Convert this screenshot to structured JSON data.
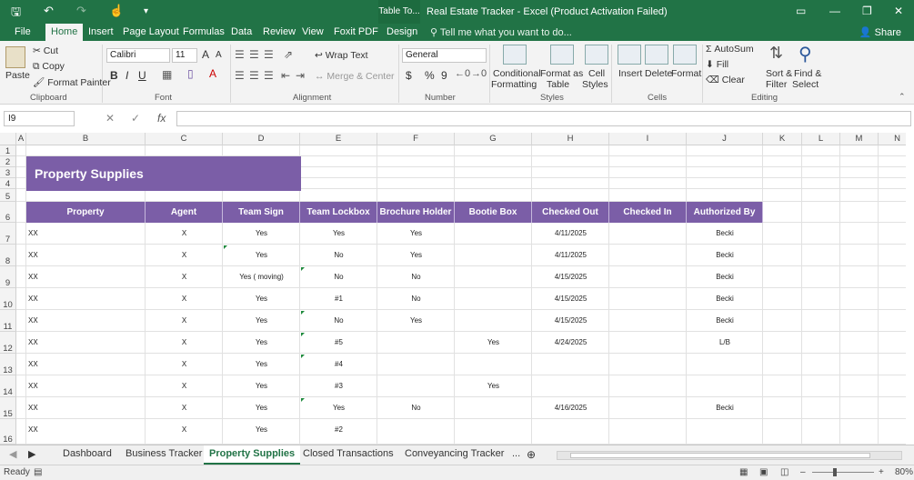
{
  "titlebar": {
    "context_tab": "Table To...",
    "title": "Real Estate Tracker - Excel (Product Activation Failed)"
  },
  "tabs": [
    "File",
    "Home",
    "Insert",
    "Page Layout",
    "Formulas",
    "Data",
    "Review",
    "View",
    "Foxit PDF",
    "Design"
  ],
  "tell_me": "Tell me what you want to do...",
  "share": "Share",
  "ribbon": {
    "clipboard": {
      "paste": "Paste",
      "cut": "Cut",
      "copy": "Copy",
      "format_painter": "Format Painter",
      "group": "Clipboard"
    },
    "font": {
      "name": "Calibri",
      "size": "11",
      "bold": "B",
      "italic": "I",
      "underline": "U",
      "grow": "A",
      "shrink": "A",
      "group": "Font"
    },
    "alignment": {
      "wrap": "Wrap Text",
      "merge": "Merge & Center",
      "group": "Alignment"
    },
    "number": {
      "format": "General",
      "currency": "$",
      "percent": "%",
      "comma": "9",
      "group": "Number"
    },
    "styles": {
      "conditional": "Conditional",
      "conditional2": "Formatting",
      "format_as": "Format as",
      "format_as2": "Table",
      "cell": "Cell",
      "cell2": "Styles",
      "group": "Styles"
    },
    "cells": {
      "insert": "Insert",
      "delete": "Delete",
      "format": "Format",
      "group": "Cells"
    },
    "editing": {
      "autosum": "AutoSum",
      "fill": "Fill",
      "clear": "Clear",
      "sort": "Sort &",
      "sort2": "Filter",
      "find": "Find &",
      "find2": "Select",
      "group": "Editing"
    }
  },
  "formula_bar": {
    "name_box": "I9",
    "cancel": "✕",
    "enter": "✓",
    "fx": "fx",
    "value": ""
  },
  "columns": [
    "A",
    "B",
    "C",
    "D",
    "E",
    "F",
    "G",
    "H",
    "I",
    "J",
    "K",
    "L",
    "M",
    "N"
  ],
  "rows": [
    "1",
    "2",
    "3",
    "4",
    "5",
    "6",
    "7",
    "8",
    "9",
    "10",
    "11",
    "12",
    "13",
    "14",
    "15",
    "16"
  ],
  "banner_title": "Property Supplies",
  "table_headers": [
    "Property",
    "Agent",
    "Team Sign",
    "Team Lockbox",
    "Brochure Holder",
    "Bootie Box",
    "Checked Out",
    "Checked In",
    "Authorized By"
  ],
  "table_rows": [
    [
      "XX",
      "X",
      "Yes",
      "Yes",
      "Yes",
      "",
      "4/11/2025",
      "",
      "Becki"
    ],
    [
      "XX",
      "X",
      "Yes",
      "No",
      "Yes",
      "",
      "4/11/2025",
      "",
      "Becki"
    ],
    [
      "XX",
      "X",
      "Yes ( moving)",
      "No",
      "No",
      "",
      "4/15/2025",
      "",
      "Becki"
    ],
    [
      "XX",
      "X",
      "Yes",
      "#1",
      "No",
      "",
      "4/15/2025",
      "",
      "Becki"
    ],
    [
      "XX",
      "X",
      "Yes",
      "No",
      "Yes",
      "",
      "4/15/2025",
      "",
      "Becki"
    ],
    [
      "XX",
      "X",
      "Yes",
      "#5",
      "",
      "Yes",
      "4/24/2025",
      "",
      "L/B"
    ],
    [
      "XX",
      "X",
      "Yes",
      "#4",
      "",
      "",
      "",
      "",
      ""
    ],
    [
      "XX",
      "X",
      "Yes",
      "#3",
      "",
      "Yes",
      "",
      "",
      ""
    ],
    [
      "XX",
      "X",
      "Yes",
      "Yes",
      "No",
      "",
      "4/16/2025",
      "",
      "Becki"
    ],
    [
      "XX",
      "X",
      "Yes",
      "#2",
      "",
      "",
      "",
      "",
      ""
    ]
  ],
  "sheet_tabs": [
    "Dashboard",
    "Business Tracker",
    "Property Supplies",
    "Closed Transactions",
    "Conveyancing Tracker"
  ],
  "sheet_more": "...",
  "status": {
    "ready": "Ready",
    "zoom": "80%"
  }
}
